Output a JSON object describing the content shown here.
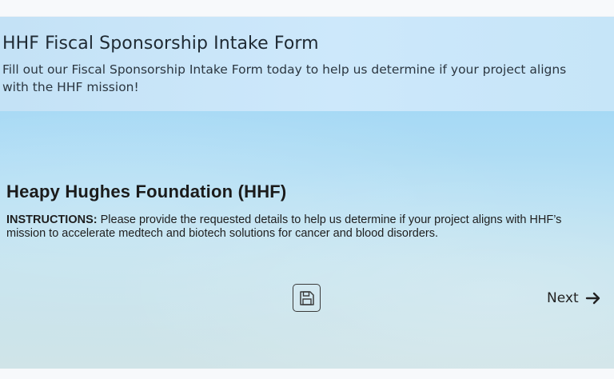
{
  "header": {
    "title": "HHF Fiscal Sponsorship Intake Form",
    "subtitle": "Fill out our Fiscal Sponsorship Intake Form today to help us determine if your project aligns with the HHF mission!"
  },
  "form": {
    "org_title": "Heapy Hughes Foundation (HHF)",
    "instructions_label": "INSTRUCTIONS:",
    "instructions_text": " Please provide the requested details to help us determine if your project aligns with HHF’s mission to accelerate medtech and biotech solutions for cancer and blood disorders."
  },
  "actions": {
    "save_icon": "save-icon",
    "next_label": "Next",
    "next_icon": "arrow-right-icon"
  }
}
